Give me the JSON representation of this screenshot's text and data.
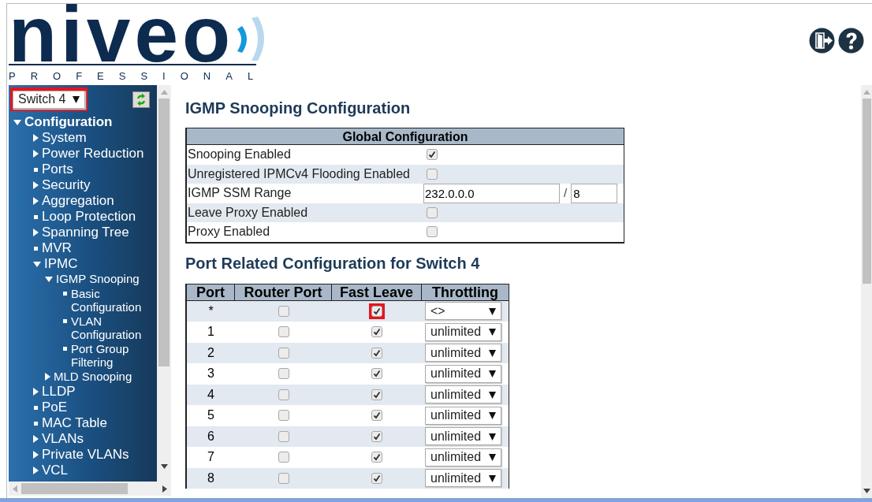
{
  "logo": {
    "name": "niveo",
    "tagline": "PROFESSIONAL"
  },
  "switch_select": {
    "value": "Switch 4",
    "highlighted": true
  },
  "sidebar": {
    "items": [
      {
        "label": "Configuration",
        "kind": "folder",
        "expanded": true,
        "children": [
          {
            "label": "System",
            "kind": "folder",
            "expanded": false
          },
          {
            "label": "Power Reduction",
            "kind": "folder",
            "expanded": false
          },
          {
            "label": "Ports",
            "kind": "page"
          },
          {
            "label": "Security",
            "kind": "folder",
            "expanded": false
          },
          {
            "label": "Aggregation",
            "kind": "folder",
            "expanded": false
          },
          {
            "label": "Loop Protection",
            "kind": "page"
          },
          {
            "label": "Spanning Tree",
            "kind": "folder",
            "expanded": false
          },
          {
            "label": "MVR",
            "kind": "page"
          },
          {
            "label": "IPMC",
            "kind": "folder",
            "expanded": true,
            "children": [
              {
                "label": "IGMP Snooping",
                "kind": "folder",
                "expanded": true,
                "children": [
                  {
                    "label": "Basic Configuration",
                    "kind": "page"
                  },
                  {
                    "label": "VLAN Configuration",
                    "kind": "page"
                  },
                  {
                    "label": "Port Group Filtering",
                    "kind": "page"
                  }
                ]
              },
              {
                "label": "MLD Snooping",
                "kind": "folder",
                "expanded": false
              }
            ]
          },
          {
            "label": "LLDP",
            "kind": "folder",
            "expanded": false
          },
          {
            "label": "PoE",
            "kind": "page"
          },
          {
            "label": "MAC Table",
            "kind": "page"
          },
          {
            "label": "VLANs",
            "kind": "folder",
            "expanded": false
          },
          {
            "label": "Private VLANs",
            "kind": "folder",
            "expanded": false
          },
          {
            "label": "VCL",
            "kind": "folder",
            "expanded": false
          }
        ]
      }
    ]
  },
  "page_title": "IGMP Snooping Configuration",
  "global_config": {
    "heading": "Global Configuration",
    "rows": [
      {
        "label": "Snooping Enabled",
        "kind": "checkbox",
        "checked": true
      },
      {
        "label": "Unregistered IPMCv4 Flooding Enabled",
        "kind": "checkbox",
        "checked": false
      },
      {
        "label": "IGMP SSM Range",
        "kind": "range",
        "value": "232.0.0.0",
        "separator": "/",
        "mask": "8"
      },
      {
        "label": "Leave Proxy Enabled",
        "kind": "checkbox",
        "checked": false
      },
      {
        "label": "Proxy Enabled",
        "kind": "checkbox",
        "checked": false
      }
    ]
  },
  "port_section_title": "Port Related Configuration for Switch 4",
  "port_table": {
    "columns": [
      "Port",
      "Router Port",
      "Fast Leave",
      "Throttling"
    ],
    "rows": [
      {
        "port": "*",
        "router_port": false,
        "fast_leave": true,
        "throttling": "<>",
        "highlighted": true
      },
      {
        "port": "1",
        "router_port": false,
        "fast_leave": true,
        "throttling": "unlimited",
        "highlighted": false
      },
      {
        "port": "2",
        "router_port": false,
        "fast_leave": true,
        "throttling": "unlimited",
        "highlighted": false
      },
      {
        "port": "3",
        "router_port": false,
        "fast_leave": true,
        "throttling": "unlimited",
        "highlighted": false
      },
      {
        "port": "4",
        "router_port": false,
        "fast_leave": true,
        "throttling": "unlimited",
        "highlighted": false
      },
      {
        "port": "5",
        "router_port": false,
        "fast_leave": true,
        "throttling": "unlimited",
        "highlighted": false
      },
      {
        "port": "6",
        "router_port": false,
        "fast_leave": true,
        "throttling": "unlimited",
        "highlighted": false
      },
      {
        "port": "7",
        "router_port": false,
        "fast_leave": true,
        "throttling": "unlimited",
        "highlighted": false
      },
      {
        "port": "8",
        "router_port": false,
        "fast_leave": true,
        "throttling": "unlimited",
        "highlighted": false
      }
    ]
  }
}
